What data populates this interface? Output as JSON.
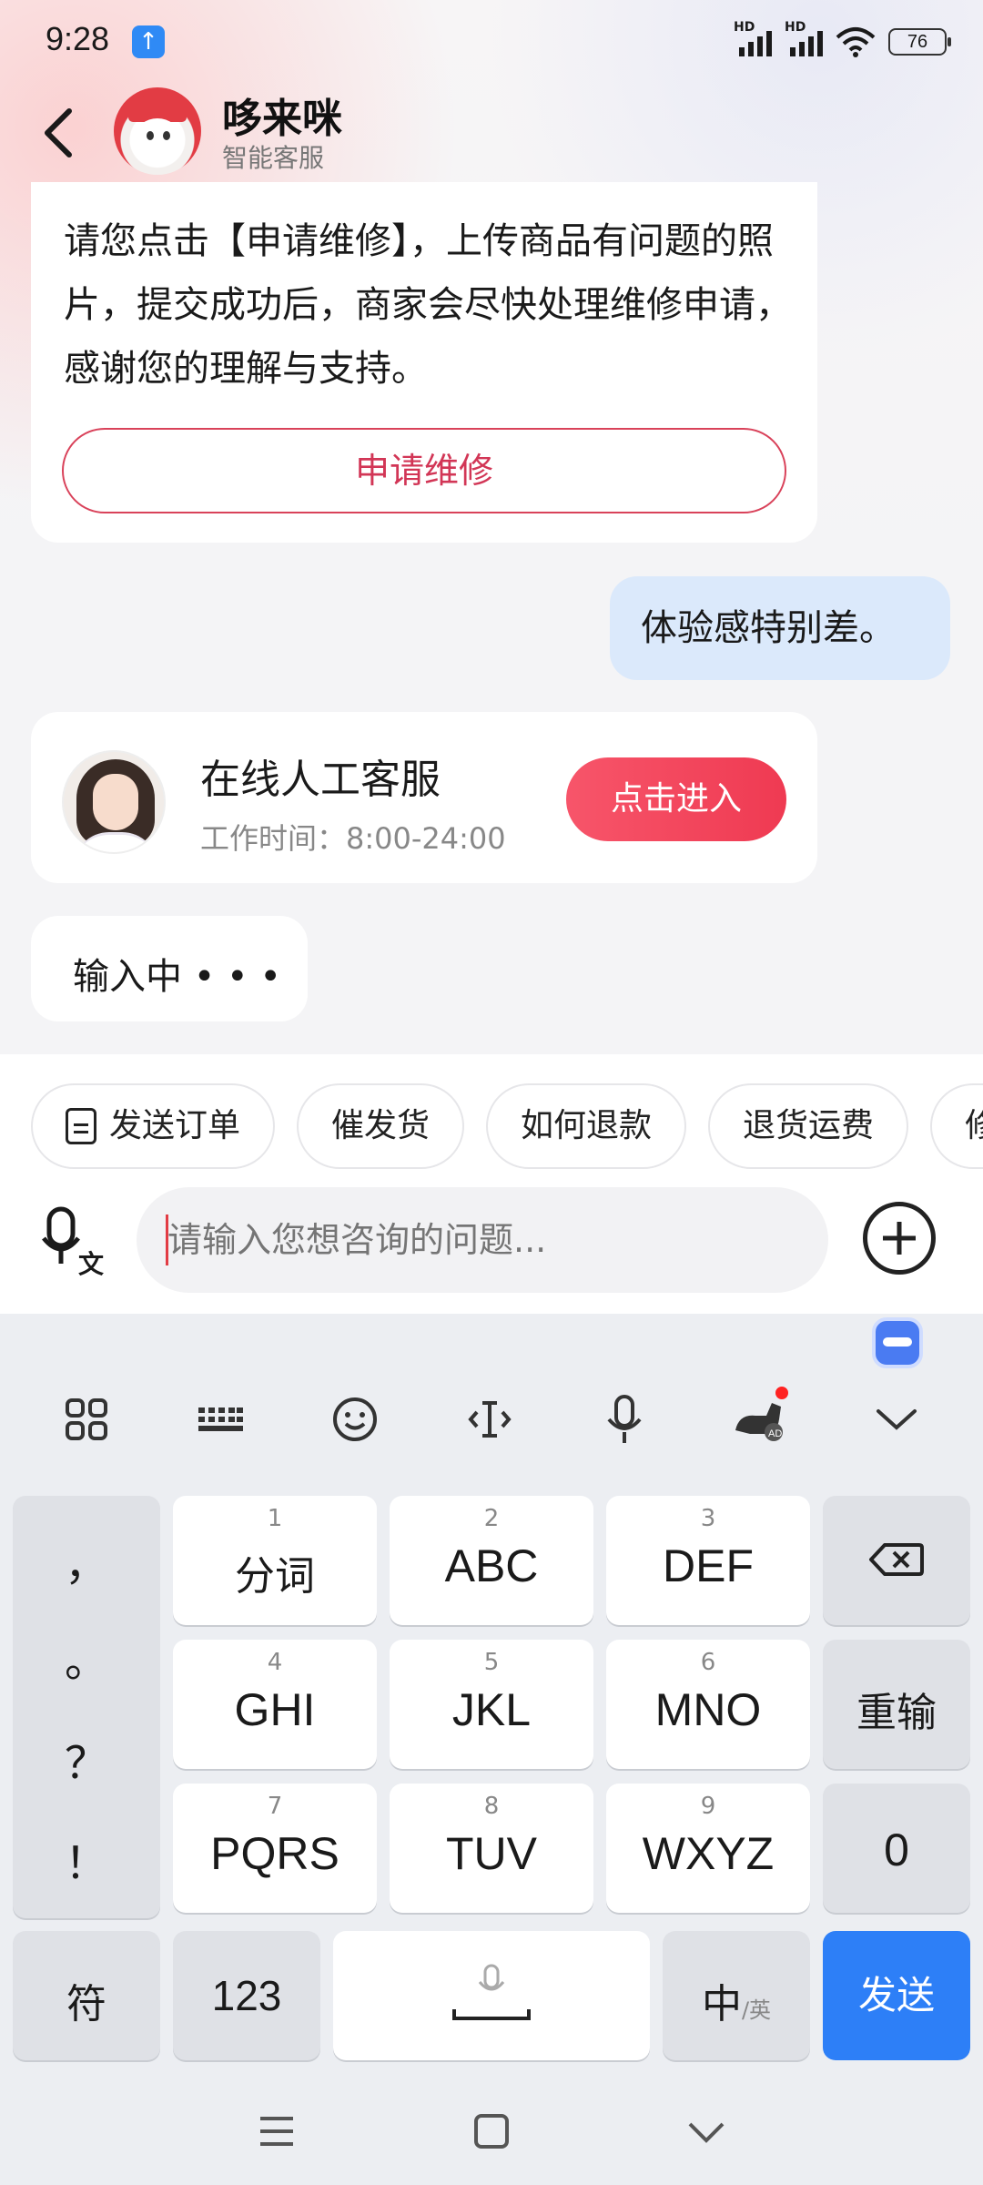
{
  "status_bar": {
    "time": "9:28",
    "battery": "76",
    "hd_label": "HD"
  },
  "header": {
    "title": "哆来咪",
    "subtitle": "智能客服"
  },
  "messages": {
    "bot_text": "请您点击【申请维修】，上传商品有问题的照片，提交成功后，商家会尽快处理维修申请，感谢您的理解与支持。",
    "repair_button": "申请维修",
    "user_text": "体验感特别差。",
    "agent_card": {
      "name": "在线人工客服",
      "hours": "工作时间：8:00-24:00",
      "enter_button": "点击进入"
    },
    "typing": "输入中 • • •"
  },
  "quick_actions": [
    "发送订单",
    "催发货",
    "如何退款",
    "退货运费",
    "修"
  ],
  "composer": {
    "placeholder": "请输入您想咨询的问题..."
  },
  "keyboard": {
    "punctuation": [
      "，",
      "。",
      "？",
      "！"
    ],
    "keys": [
      {
        "num": "1",
        "label": "分词"
      },
      {
        "num": "2",
        "label": "ABC"
      },
      {
        "num": "3",
        "label": "DEF"
      },
      {
        "num": "4",
        "label": "GHI"
      },
      {
        "num": "5",
        "label": "JKL"
      },
      {
        "num": "6",
        "label": "MNO"
      },
      {
        "num": "7",
        "label": "PQRS"
      },
      {
        "num": "8",
        "label": "TUV"
      },
      {
        "num": "9",
        "label": "WXYZ"
      }
    ],
    "retype": "重输",
    "zero": "0",
    "symbols": "符",
    "numbers": "123",
    "lang_main": "中",
    "lang_alt": "/英",
    "send": "发送"
  },
  "colors": {
    "accent_red": "#ef3a52",
    "send_blue": "#2d7ff7",
    "user_bubble": "#dbe9fb"
  }
}
